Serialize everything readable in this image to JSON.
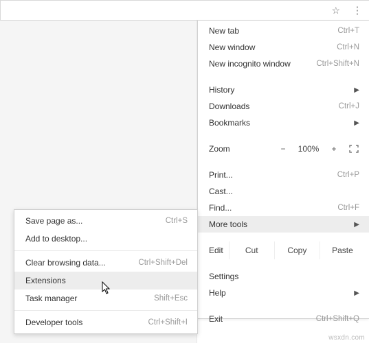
{
  "toolbar": {
    "star_icon": "star-icon",
    "menu_icon": "more-vertical-icon"
  },
  "menu": {
    "new_tab": {
      "label": "New tab",
      "shortcut": "Ctrl+T"
    },
    "new_window": {
      "label": "New window",
      "shortcut": "Ctrl+N"
    },
    "new_incognito": {
      "label": "New incognito window",
      "shortcut": "Ctrl+Shift+N"
    },
    "history": {
      "label": "History"
    },
    "downloads": {
      "label": "Downloads",
      "shortcut": "Ctrl+J"
    },
    "bookmarks": {
      "label": "Bookmarks"
    },
    "zoom": {
      "label": "Zoom",
      "minus": "−",
      "value": "100%",
      "plus": "+"
    },
    "print": {
      "label": "Print...",
      "shortcut": "Ctrl+P"
    },
    "cast": {
      "label": "Cast..."
    },
    "find": {
      "label": "Find...",
      "shortcut": "Ctrl+F"
    },
    "more_tools": {
      "label": "More tools"
    },
    "edit": {
      "label": "Edit",
      "cut": "Cut",
      "copy": "Copy",
      "paste": "Paste"
    },
    "settings": {
      "label": "Settings"
    },
    "help": {
      "label": "Help"
    },
    "exit": {
      "label": "Exit",
      "shortcut": "Ctrl+Shift+Q"
    }
  },
  "submenu": {
    "save_page": {
      "label": "Save page as...",
      "shortcut": "Ctrl+S"
    },
    "add_desktop": {
      "label": "Add to desktop..."
    },
    "clear_data": {
      "label": "Clear browsing data...",
      "shortcut": "Ctrl+Shift+Del"
    },
    "extensions": {
      "label": "Extensions"
    },
    "task_manager": {
      "label": "Task manager",
      "shortcut": "Shift+Esc"
    },
    "dev_tools": {
      "label": "Developer tools",
      "shortcut": "Ctrl+Shift+I"
    }
  },
  "footer": "wsxdn.com"
}
